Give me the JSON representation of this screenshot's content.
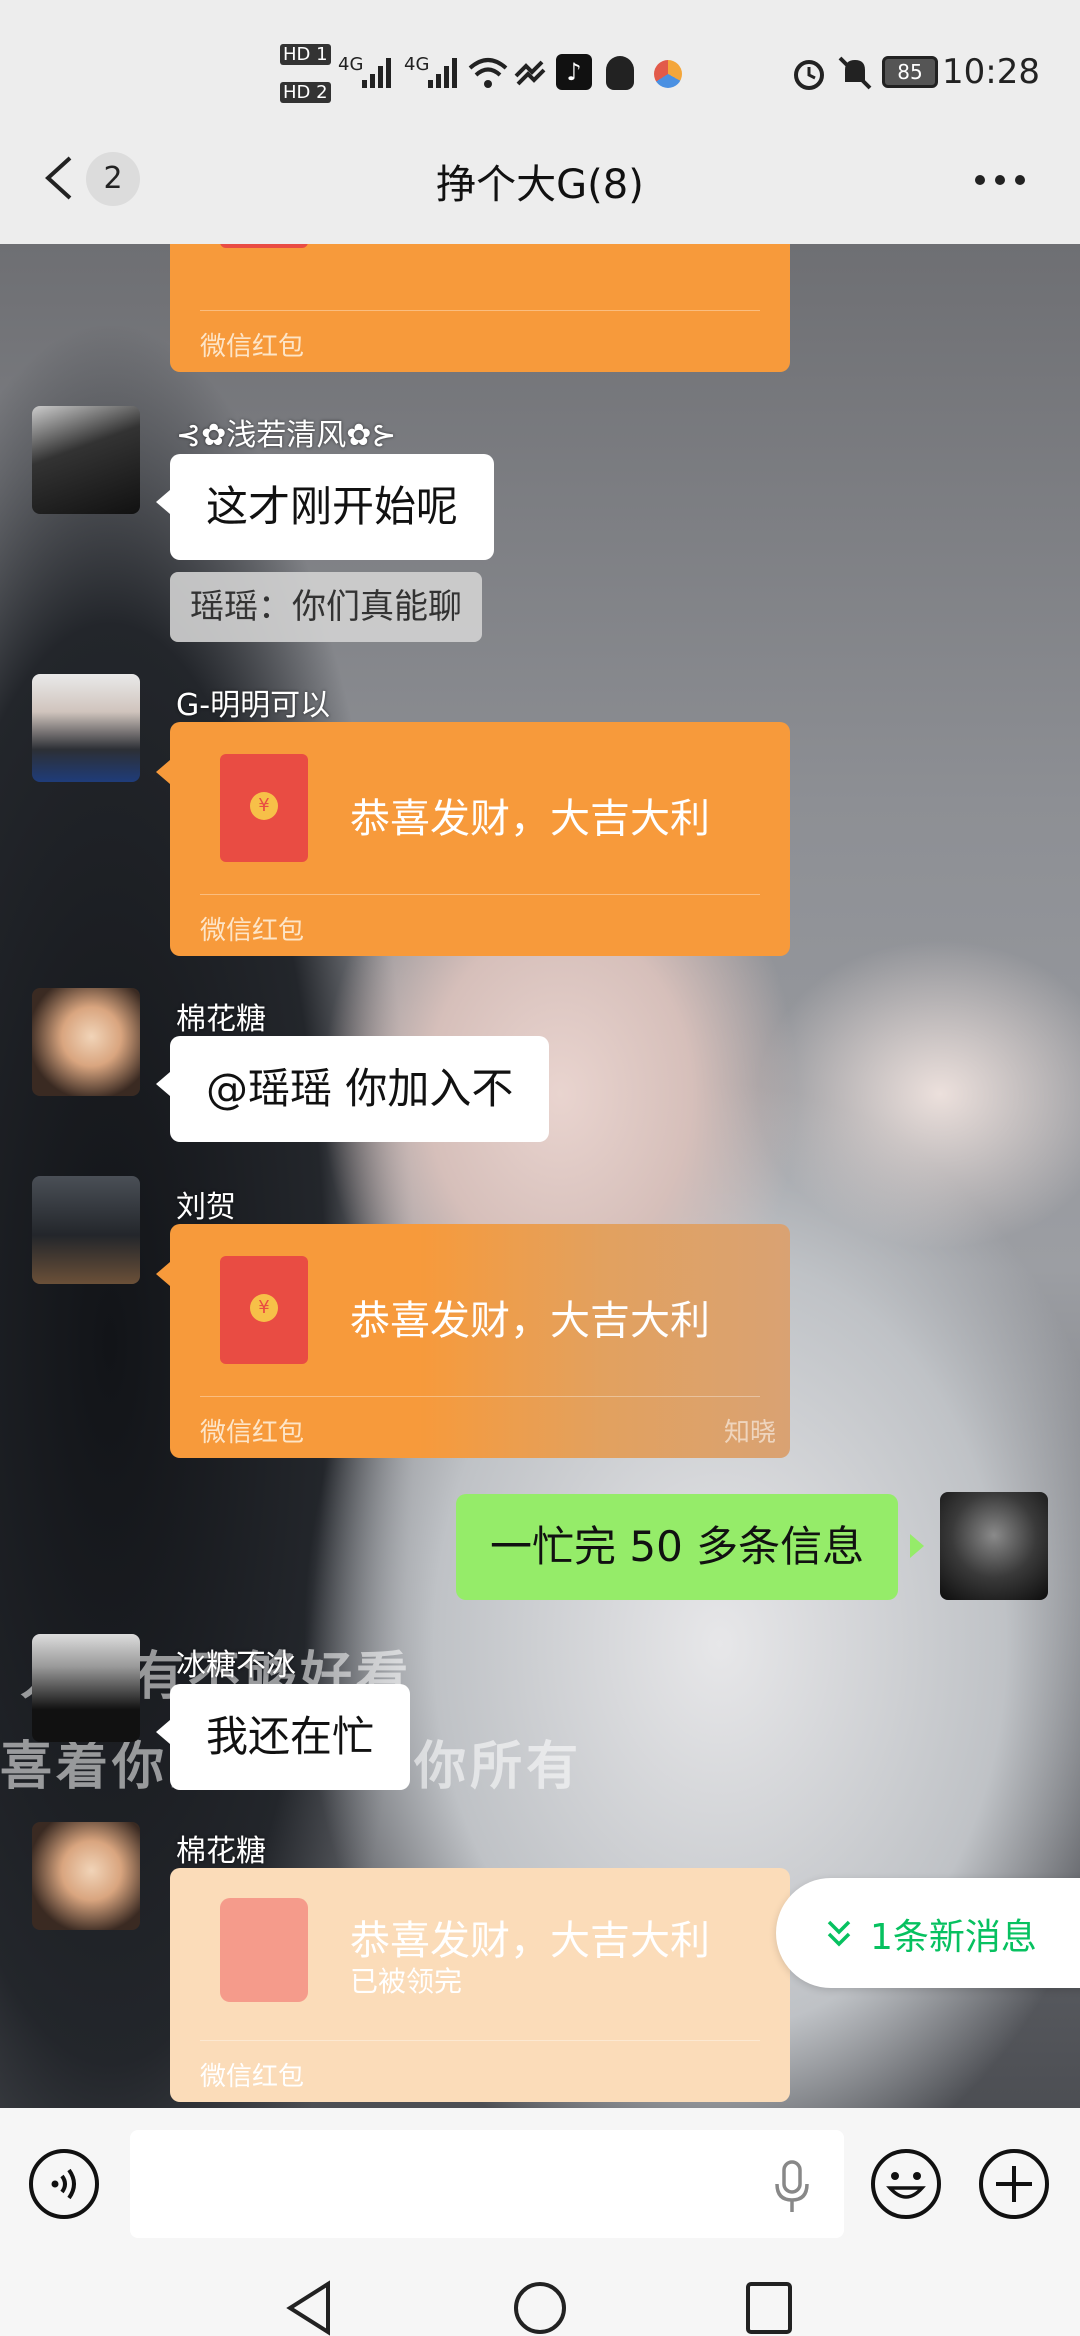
{
  "status_bar": {
    "left_labels": [
      "HD 1",
      "HD 2",
      "4G",
      "4G"
    ],
    "battery": "85",
    "time": "10:28",
    "icons": [
      "signal-icon",
      "wifi-icon",
      "tiktok-icon",
      "qq-icon",
      "app-icon",
      "alarm-icon",
      "mute-icon",
      "battery-icon"
    ]
  },
  "nav": {
    "back_count": "2",
    "title": "挣个大G(8)"
  },
  "messages": [
    {
      "type": "redpacket_partial",
      "footer": "微信红包"
    },
    {
      "type": "text",
      "sender": "⊰✿浅若清风✿⊱",
      "text": "这才刚开始呢"
    },
    {
      "type": "system",
      "text": "瑶瑶：你们真能聊"
    },
    {
      "type": "redpacket",
      "sender": "G-明明可以",
      "text": "恭喜发财，大吉大利",
      "footer": "微信红包"
    },
    {
      "type": "text",
      "sender": "棉花糖",
      "text": "@瑶瑶  你加入不"
    },
    {
      "type": "redpacket",
      "sender": "刘贺",
      "text": "恭喜发财，大吉大利",
      "footer": "微信红包",
      "mark": "知晓"
    },
    {
      "type": "self",
      "text": "一忙完 50 多条信息"
    },
    {
      "type": "text",
      "sender": "冰糖不冰",
      "text": "我还在忙"
    },
    {
      "type": "redpacket_opened",
      "sender": "棉花糖",
      "text": "恭喜发财，大吉大利",
      "sub": "已被领完",
      "footer": "微信红包"
    }
  ],
  "background_text": [
    "人你有不够好看",
    "喜着你的 也他爱你所有"
  ],
  "new_message": "1条新消息",
  "input": {
    "placeholder": ""
  },
  "colors": {
    "bubble_self": "#95ec69",
    "redpacket": "#f79a3b",
    "accent": "#07c160"
  }
}
